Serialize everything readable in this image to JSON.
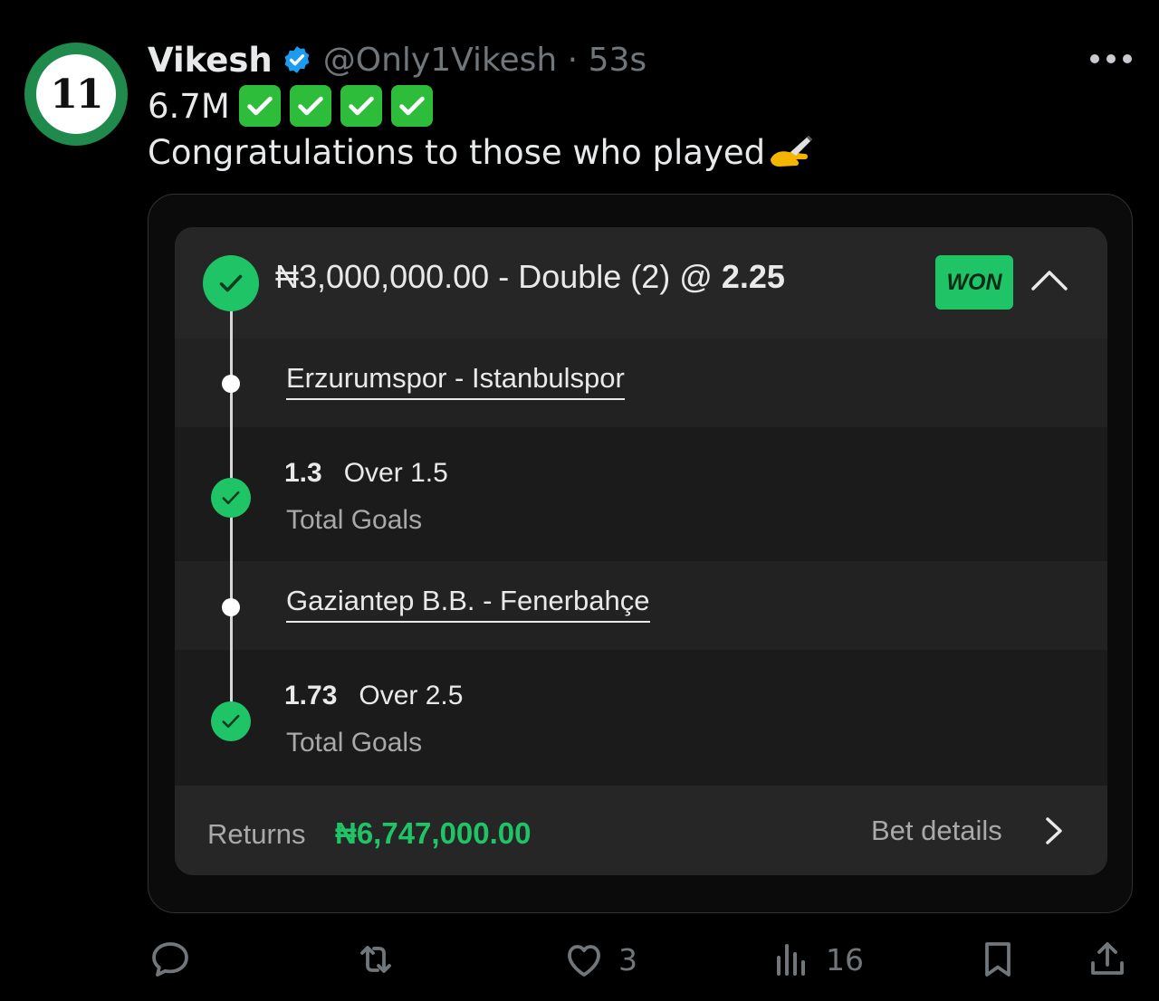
{
  "post": {
    "author_name": "Vikesh",
    "avatar_text": "11",
    "handle_time": "@Only1Vikesh · 53s",
    "line1_text": "6.7M",
    "line1_emoji": [
      "check-mark-button",
      "check-mark-button",
      "check-mark-button",
      "check-mark-button"
    ],
    "line2_text": "Congratulations to those who played"
  },
  "bet_slip": {
    "title_prefix": "₦3,000,000.00 - Double (2) @ ",
    "title_odds": "2.25",
    "status": "WON",
    "selections": [
      {
        "match": "Erzurumspor - Istanbulspor",
        "odds": "1.3",
        "pick": "Over 1.5",
        "market": "Total Goals"
      },
      {
        "match": "Gaziantep B.B. - Fenerbahçe",
        "odds": "1.73",
        "pick": "Over 2.5",
        "market": "Total Goals"
      }
    ],
    "returns_label": "Returns",
    "returns_value": "₦6,747,000.00",
    "bet_details_label": "Bet details"
  },
  "actions": {
    "reply_count": "",
    "repost_count": "",
    "like_count": "3",
    "views_count": "16"
  },
  "colors": {
    "accent_green": "#1fc466",
    "verified_blue": "#1d9bf0",
    "muted_text": "#71767b"
  }
}
